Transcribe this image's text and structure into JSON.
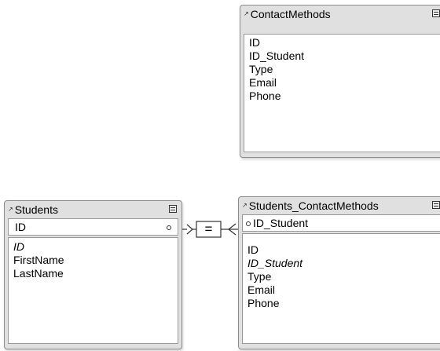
{
  "tables": {
    "contact_methods": {
      "title": "ContactMethods",
      "fields": [
        "ID",
        "ID_Student",
        "Type",
        "Email",
        "Phone"
      ]
    },
    "students": {
      "title": "Students",
      "key_field": "ID",
      "fields": [
        "ID",
        "FirstName",
        "LastName"
      ]
    },
    "students_contact_methods": {
      "title": "Students_ContactMethods",
      "key_field": "ID_Student",
      "fields": [
        "ID",
        "ID_Student",
        "Type",
        "Email",
        "Phone"
      ]
    }
  },
  "relationship": {
    "operator": "="
  }
}
